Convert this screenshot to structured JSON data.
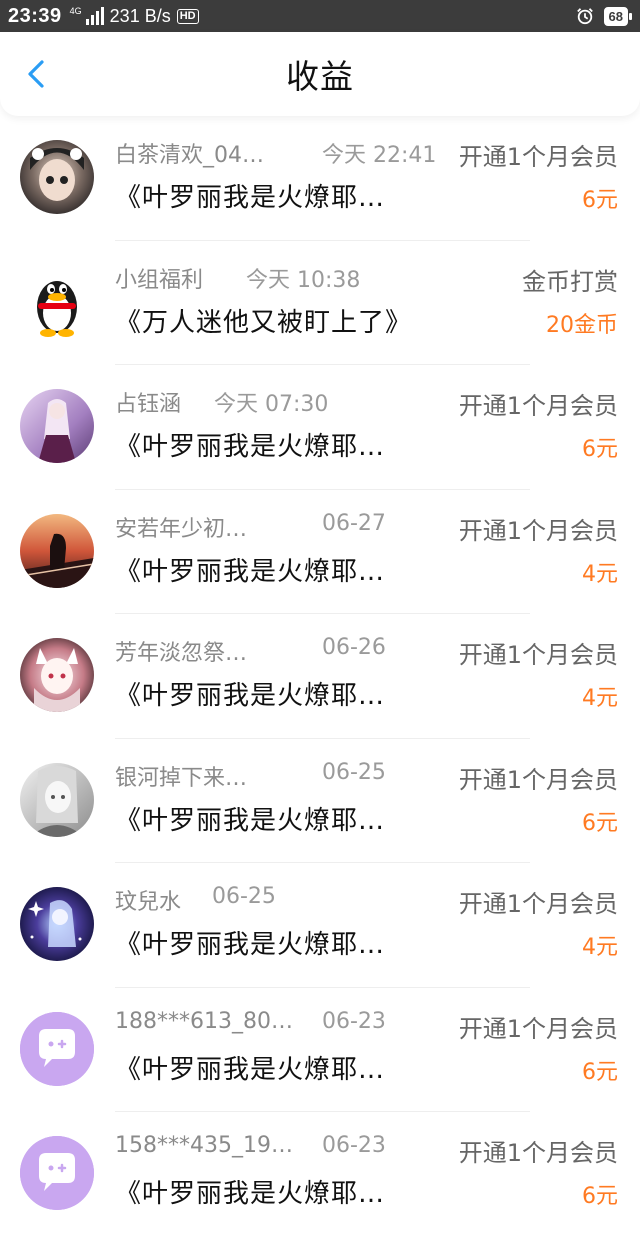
{
  "status_bar": {
    "time": "23:39",
    "network": "4G",
    "speed": "231 B/s",
    "hd": "HD",
    "battery": "68"
  },
  "header": {
    "title": "收益",
    "back_icon": "chevron-left-icon",
    "accent": "#2a9df4"
  },
  "colors": {
    "amount": "#ff7a22",
    "name": "#8a8a8a",
    "divider": "#eeeeee"
  },
  "items": [
    {
      "name": "白茶清欢_04…",
      "time": "今天 22:41",
      "type": "开通1个月会员",
      "book": "《叶罗丽我是火燎耶…",
      "amount": "6元",
      "avatar": "user-photo-avatar"
    },
    {
      "name": "小组福利",
      "time": "今天 10:38",
      "type": "金币打赏",
      "book": "《万人迷他又被盯上了》",
      "amount": "20金币",
      "avatar": "penguin-avatar"
    },
    {
      "name": "占钰涵",
      "time": "今天 07:30",
      "type": "开通1个月会员",
      "book": "《叶罗丽我是火燎耶…",
      "amount": "6元",
      "avatar": "anime-girl-avatar"
    },
    {
      "name": "安若年少初…",
      "time": "06-27",
      "type": "开通1个月会员",
      "book": "《叶罗丽我是火燎耶…",
      "amount": "4元",
      "avatar": "sunset-girl-avatar"
    },
    {
      "name": "芳年淡忽祭…",
      "time": "06-26",
      "type": "开通1个月会员",
      "book": "《叶罗丽我是火燎耶…",
      "amount": "4元",
      "avatar": "fox-girl-avatar"
    },
    {
      "name": "银河掉下来…",
      "time": "06-25",
      "type": "开通1个月会员",
      "book": "《叶罗丽我是火燎耶…",
      "amount": "6元",
      "avatar": "sketch-girl-avatar"
    },
    {
      "name": "玟兒水",
      "time": "06-25",
      "type": "开通1个月会员",
      "book": "《叶罗丽我是火燎耶…",
      "amount": "4元",
      "avatar": "galaxy-girl-avatar"
    },
    {
      "name": "188***613_80…",
      "time": "06-23",
      "type": "开通1个月会员",
      "book": "《叶罗丽我是火燎耶…",
      "amount": "6元",
      "avatar": "chat-bubble-avatar"
    },
    {
      "name": "158***435_19…",
      "time": "06-23",
      "type": "开通1个月会员",
      "book": "《叶罗丽我是火燎耶…",
      "amount": "6元",
      "avatar": "chat-bubble-avatar"
    }
  ]
}
